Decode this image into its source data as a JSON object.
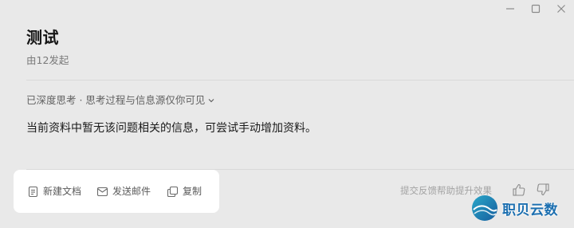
{
  "window": {
    "controls": [
      "minimize-icon",
      "maximize-icon",
      "close-icon"
    ]
  },
  "header": {
    "title": "测试",
    "subtitle": "由12发起"
  },
  "thinking": {
    "label": "已深度思考 · 思考过程与信息源仅你可见",
    "icon": "chevron-down-icon"
  },
  "answer": {
    "text": "当前资料中暂无该问题相关的信息，可尝试手动增加资料。"
  },
  "actions": [
    {
      "label": "新建文档",
      "icon": "document-icon"
    },
    {
      "label": "发送邮件",
      "icon": "mail-icon"
    },
    {
      "label": "复制",
      "icon": "copy-icon"
    }
  ],
  "feedback": {
    "label": "提交反馈帮助提升效果",
    "like_icon": "thumbs-up-icon",
    "dislike_icon": "thumbs-down-icon"
  },
  "watermark": {
    "text": "职贝云数",
    "color": "#1c6fb0"
  }
}
